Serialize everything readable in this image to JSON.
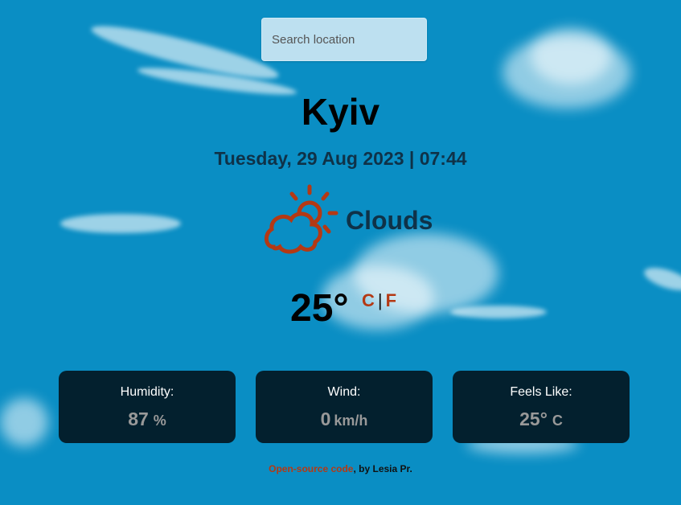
{
  "search": {
    "placeholder": "Search location"
  },
  "city": "Kyiv",
  "date_line": "Tuesday, 29 Aug 2023 | 07:44",
  "condition": {
    "icon": "partly-cloudy-icon",
    "text": "Clouds"
  },
  "temperature": {
    "value": "25°",
    "unit_c": "C",
    "unit_sep": "|",
    "unit_f": "F"
  },
  "cards": [
    {
      "label": "Humidity:",
      "value": "87",
      "unit": "%"
    },
    {
      "label": "Wind:",
      "value": "0",
      "unit": "km/h"
    },
    {
      "label": "Feels Like:",
      "value": "25°",
      "unit": "C"
    }
  ],
  "footer": {
    "link_text": "Open-source code",
    "suffix": ", by Lesia Pr."
  },
  "colors": {
    "background": "#0a8ec4",
    "accent": "#b43914",
    "card": "#03202e"
  }
}
